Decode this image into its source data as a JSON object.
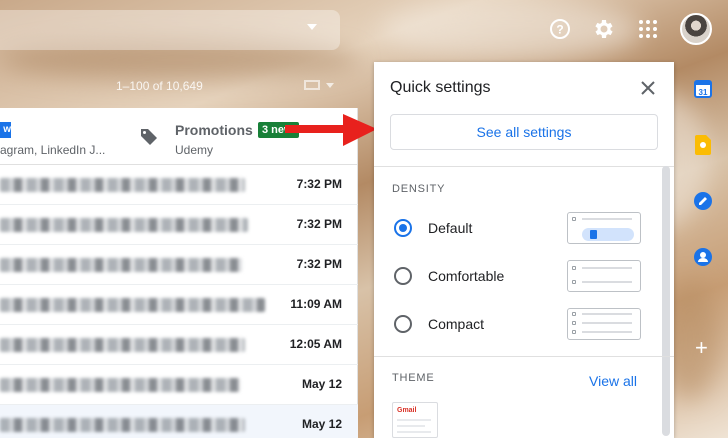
{
  "header": {
    "icons": [
      "help-icon",
      "gear-icon",
      "apps-grid-icon",
      "avatar"
    ]
  },
  "pager": {
    "text": "1–100 of 10,649"
  },
  "tabs": {
    "left_sub": "agram, LinkedIn J...",
    "left_badge": "w",
    "promotions_title": "Promotions",
    "promotions_badge": "3 new",
    "promotions_sub": "Udemy"
  },
  "mail_rows": [
    {
      "time": "7:32 PM",
      "read": false,
      "blur_width": 245
    },
    {
      "time": "7:32 PM",
      "read": false,
      "blur_width": 248
    },
    {
      "time": "7:32 PM",
      "read": false,
      "blur_width": 242
    },
    {
      "time": "11:09 AM",
      "read": false,
      "blur_width": 265
    },
    {
      "time": "12:05 AM",
      "read": false,
      "blur_width": 245
    },
    {
      "time": "May 12",
      "read": false,
      "blur_width": 240
    },
    {
      "time": "May 12",
      "read": true,
      "blur_width": 245
    }
  ],
  "quick_settings": {
    "title": "Quick settings",
    "see_all_label": "See all settings",
    "density_heading": "DENSITY",
    "density_options": [
      {
        "label": "Default",
        "checked": true
      },
      {
        "label": "Comfortable",
        "checked": false
      },
      {
        "label": "Compact",
        "checked": false
      }
    ],
    "theme_heading": "THEME",
    "view_all_label": "View all",
    "theme_thumb_label": "Gmail"
  },
  "sidebar": {
    "icons": [
      "calendar-icon",
      "keep-icon",
      "tasks-icon",
      "contacts-icon",
      "add-icon"
    ],
    "calendar_day": "31",
    "add_symbol": "+"
  },
  "colors": {
    "accent": "#1a73e8",
    "promo_badge": "#188038",
    "annotation_arrow": "#e8211d"
  }
}
